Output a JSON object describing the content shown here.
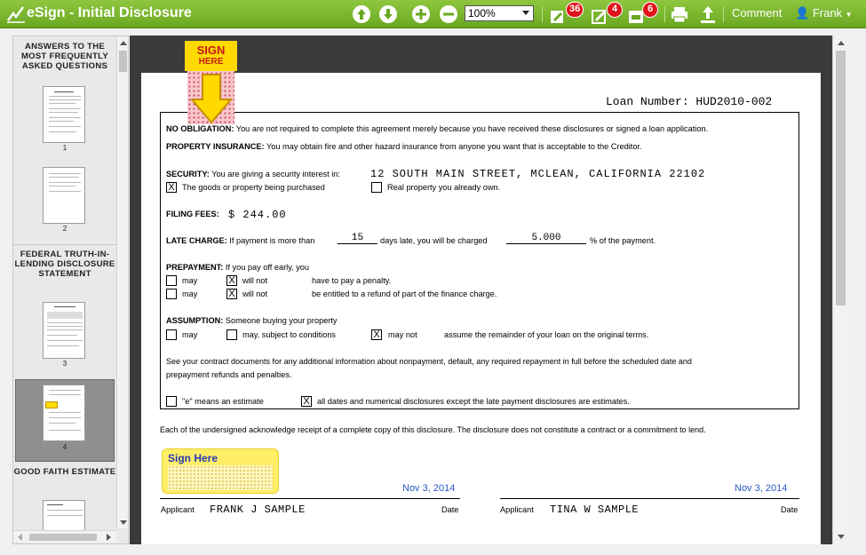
{
  "app": {
    "title": "eSign - Initial Disclosure",
    "zoom": "100%",
    "comment_label": "Comment",
    "user_name": "Frank",
    "badges": {
      "pending": "36",
      "signatures": "4",
      "initials": "6"
    }
  },
  "sidebar": {
    "sections": [
      "ANSWERS TO THE MOST FREQUENTLY ASKED QUESTIONS",
      "FEDERAL TRUTH-IN-LENDING DISCLOSURE STATEMENT",
      "GOOD FAITH ESTIMATE"
    ],
    "pages": [
      "1",
      "2",
      "3",
      "4"
    ],
    "selected_page": "4"
  },
  "sign_flag": {
    "line1": "SIGN",
    "line2": "HERE"
  },
  "document": {
    "loan_number": "Loan Number: HUD2010-002",
    "no_obligation_label": "NO OBLIGATION:",
    "no_obligation_text": "You are not required to complete this agreement merely because you have received these disclosures or signed a loan application.",
    "property_insurance_label": "PROPERTY INSURANCE:",
    "property_insurance_text": "You may obtain fire and other hazard insurance from anyone you want that is acceptable to the Creditor.",
    "security_label": "SECURITY:",
    "security_text": "You are giving a security interest in:",
    "security_address": "12 SOUTH MAIN STREET, MCLEAN, CALIFORNIA 22102",
    "goods_option": "The goods or property being purchased",
    "real_property_option": "Real property you already own.",
    "filing_fees_label": "FILING FEES:",
    "filing_fees_value": "$ 244.00",
    "late_charge_label": "LATE CHARGE:",
    "late_charge_text1": "If payment is more than",
    "late_days": "15",
    "late_charge_text2": "days late, you will be charged",
    "late_percent": "5.000",
    "late_charge_text3": "% of the payment.",
    "prepayment_label": "PREPAYMENT:",
    "prepayment_text": "If you pay off early, you",
    "may": "may",
    "will_not": "will not",
    "prepay_penalty": "have to pay a penalty.",
    "prepay_refund": "be entitled to a refund of part of the finance charge.",
    "assumption_label": "ASSUMPTION:",
    "assumption_text": "Someone buying your property",
    "may_subject": "may, subject to conditions",
    "may_not": "may not",
    "assumption_remainder": "assume the remainder of your loan on the original terms.",
    "contract_line1": "See your contract documents for any additional information about nonpayment, default, any required repayment in full before the scheduled date and",
    "contract_line2": "prepayment refunds and penalties.",
    "estimate_option": "\"e\" means an estimate",
    "all_dates_option": "all dates and numerical disclosures except the late payment disclosures are estimates.",
    "acknowledge": "Each of the undersigned acknowledge receipt of a complete copy of this disclosure.  The disclosure does not constitute  a contract  or a commitment to lend.",
    "sign_here": "Sign Here",
    "applicant_label": "Applicant",
    "date_label": "Date",
    "applicant1": "FRANK J SAMPLE",
    "applicant2": "TINA W SAMPLE",
    "date1": "Nov 3, 2014",
    "date2": "Nov 3, 2014",
    "check_mark": "X"
  },
  "colors": {
    "toolbar": "#7ab935",
    "badge": "#e0121a",
    "flag": "#ffd900",
    "link": "#2a56c6"
  }
}
